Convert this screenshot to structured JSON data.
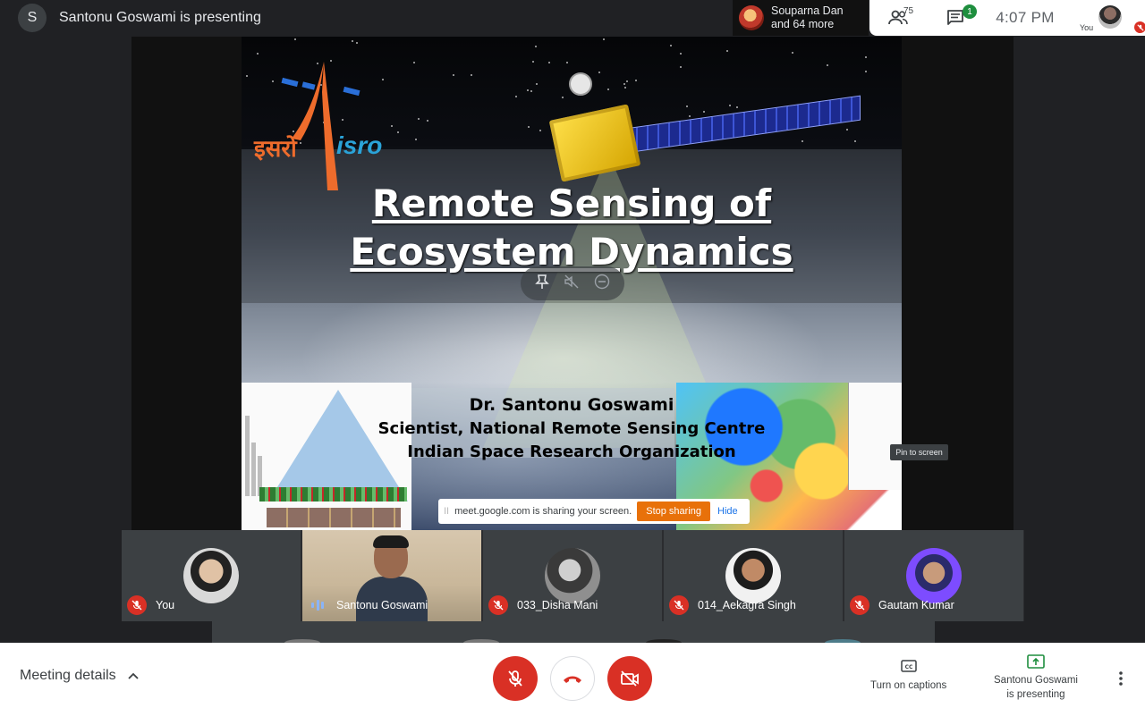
{
  "header": {
    "presenter_initial": "S",
    "presenting_text": "Santonu Goswami is presenting",
    "raised_chip": {
      "line1": "Souparna Dan",
      "line2": "and 64 more"
    },
    "people_count": "75",
    "chat_badge": "1",
    "time": "4:07  PM",
    "self_label": "You"
  },
  "slide": {
    "logo_hindi": "इसरो",
    "logo_english": "isro",
    "title_line1": "Remote Sensing of ",
    "title_line2": "Ecosystem Dynamics",
    "presenter_name": "Dr. Santonu Goswami",
    "presenter_role": "Scientist, National Remote Sensing Centre",
    "presenter_org": "Indian Space Research Organization"
  },
  "share_bar": {
    "grip": "II",
    "message": "meet.google.com is sharing your screen.",
    "stop_label": "Stop sharing",
    "hide_label": "Hide"
  },
  "tooltip": "Pin to screen",
  "participants": [
    {
      "name": "You",
      "muted": true
    },
    {
      "name": "Santonu Goswami",
      "muted": false
    },
    {
      "name": "033_Disha Mani",
      "muted": true
    },
    {
      "name": "014_Aekagra Singh",
      "muted": true
    },
    {
      "name": "Gautam Kumar",
      "muted": true
    }
  ],
  "bottom": {
    "meeting_details": "Meeting details",
    "captions_label": "Turn on captions",
    "presenting_line1": "Santonu Goswami",
    "presenting_line2": "is presenting"
  },
  "colors": {
    "danger": "#d93025",
    "share_orange": "#e8710a",
    "link_blue": "#1a73e8",
    "badge_green": "#1e8e3e",
    "isro_orange": "#ee6c2c",
    "isro_blue": "#2aa3d8"
  },
  "icons": [
    "people-icon",
    "chat-icon",
    "pin-icon",
    "mute-speaker-icon",
    "remove-icon",
    "mic-off-icon",
    "hangup-icon",
    "camera-off-icon",
    "captions-icon",
    "present-icon",
    "more-vert-icon",
    "chevron-up-icon"
  ]
}
